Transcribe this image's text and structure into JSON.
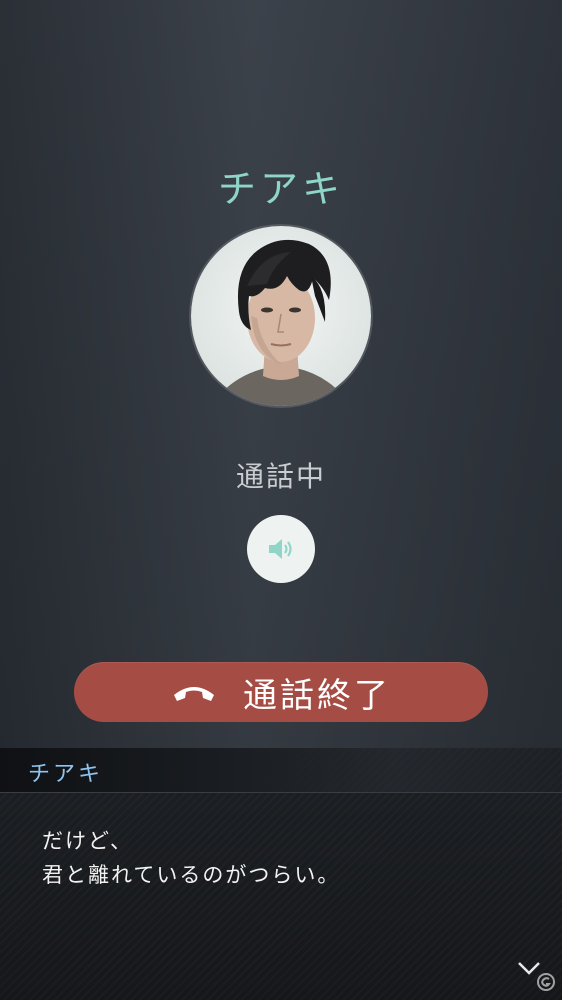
{
  "call": {
    "caller_name": "チアキ",
    "status": "通話中",
    "end_call_label": "通話終了",
    "speaker_icon": "speaker-volume-icon",
    "end_call_icon": "hang-up-phone-icon"
  },
  "dialogue": {
    "speaker": "チアキ",
    "lines": [
      "だけど、",
      "君と離れているのがつらい。"
    ],
    "advance_icon": "chevron-down-icon"
  },
  "colors": {
    "accent_name": "#8fd6c9",
    "end_call_button": "#a54d44",
    "speaker_name": "#8ec5f0",
    "background": "#30353d"
  }
}
